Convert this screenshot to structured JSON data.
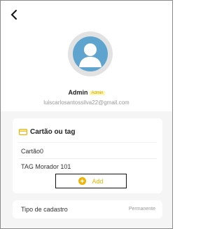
{
  "header": {
    "back_icon": "chevron-left-icon"
  },
  "profile": {
    "avatar_icon": "user-avatar-icon",
    "name": "Admin",
    "role_badge": "Admin",
    "email": "luiscarlosantossilva22@gmail.com"
  },
  "card_section": {
    "icon": "card-icon",
    "title": "Cartão ou tag",
    "items": [
      {
        "label": "Cartão0"
      },
      {
        "label": "TAG Morador 101"
      }
    ],
    "add_icon": "plus-circle-icon",
    "add_label": "Add"
  },
  "registration": {
    "label": "Tipo de cadastro",
    "value": "Permanente"
  },
  "colors": {
    "accent": "#f0b400",
    "avatar_bg": "#5fa4cf",
    "page_bg": "#f5f5f5"
  }
}
